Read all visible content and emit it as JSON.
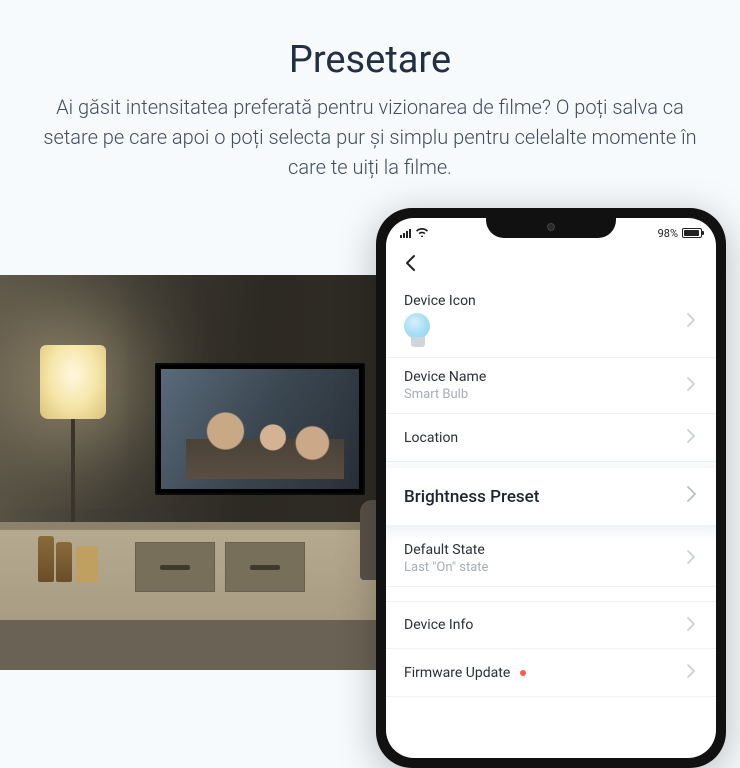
{
  "header": {
    "title": "Presetare",
    "subtitle": "Ai găsit intensitatea preferată pentru vizionarea de filme? O poți salva ca setare pe care apoi o poți selecta pur și simplu pentru celelalte momente în care te uiți la filme."
  },
  "phone": {
    "status": {
      "battery_text": "98%"
    },
    "rows": {
      "device_icon": {
        "label": "Device Icon"
      },
      "device_name": {
        "label": "Device Name",
        "value": "Smart Bulb"
      },
      "location": {
        "label": "Location"
      },
      "brightness_preset": {
        "label": "Brightness Preset"
      },
      "default_state": {
        "label": "Default State",
        "value": "Last \"On\" state"
      },
      "device_info": {
        "label": "Device Info"
      },
      "firmware_update": {
        "label": "Firmware Update"
      }
    }
  }
}
